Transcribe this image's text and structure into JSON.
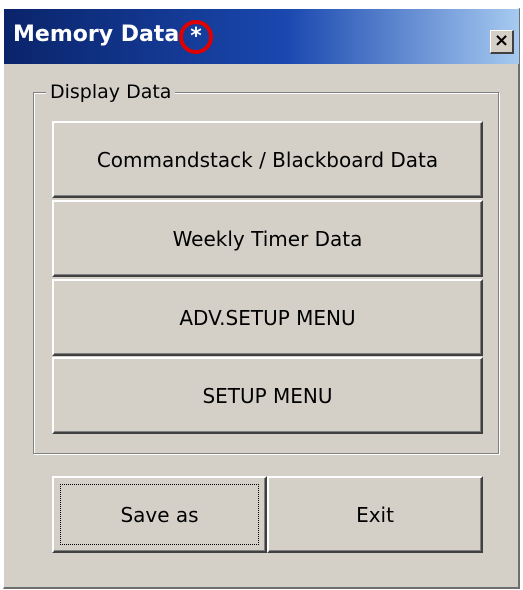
{
  "window": {
    "title": "Memory Data",
    "modified_marker": "*",
    "close_label": "×"
  },
  "display_group": {
    "label": "Display Data",
    "buttons": [
      "Commandstack / Blackboard Data",
      "Weekly Timer Data",
      "ADV.SETUP MENU",
      "SETUP MENU"
    ]
  },
  "footer": {
    "save_as_label": "Save as",
    "exit_label": "Exit"
  },
  "colors": {
    "title_gradient_start": "#0a246a",
    "title_gradient_end": "#a6caf0",
    "window_face": "#d4d0c8",
    "highlight_circle": "#e00000"
  }
}
